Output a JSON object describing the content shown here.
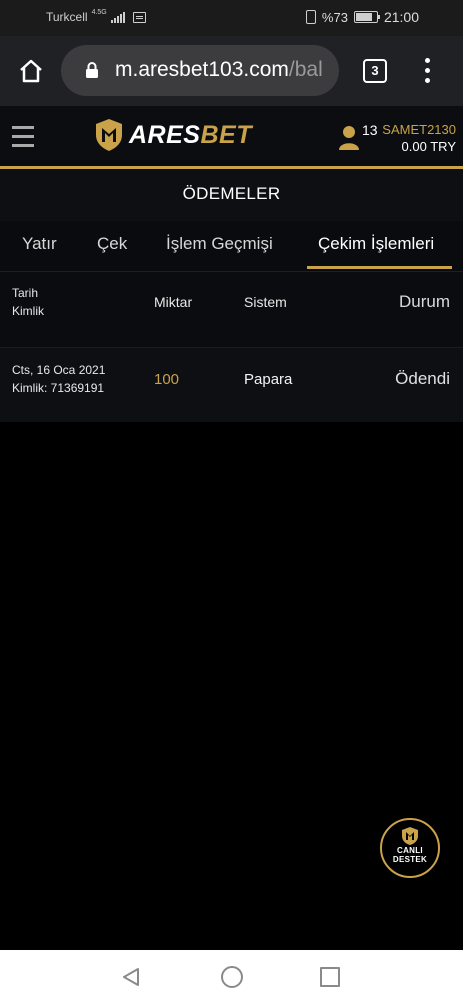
{
  "status_bar": {
    "carrier": "Turkcell",
    "network": "4.5G",
    "battery": "%73",
    "time": "21:00"
  },
  "browser": {
    "url_main": "m.aresbet103.com",
    "url_rest": "/bal",
    "tab_count": "3"
  },
  "header": {
    "logo_white": "ARES",
    "logo_gold": "BET",
    "user_count": "13",
    "username": "SAMET2130",
    "balance": "0.00 TRY"
  },
  "page_title": "ÖDEMELER",
  "tabs": [
    {
      "label": "Yatır"
    },
    {
      "label": "Çek"
    },
    {
      "label": "İşlem Geçmişi"
    },
    {
      "label": "Çekim İşlemleri",
      "active": true
    }
  ],
  "table": {
    "headers": {
      "date": "Tarih",
      "id": "Kimlik",
      "amount": "Miktar",
      "system": "Sistem",
      "status": "Durum"
    },
    "rows": [
      {
        "date": "Cts, 16 Oca 2021",
        "id": "Kimlik: 71369191",
        "amount": "100",
        "system": "Papara",
        "status": "Ödendi"
      }
    ]
  },
  "live_support": {
    "line1": "CANLI",
    "line2": "DESTEK"
  },
  "colors": {
    "accent": "#c9a24a",
    "background": "#000000",
    "header_bg": "#0c0d10"
  }
}
